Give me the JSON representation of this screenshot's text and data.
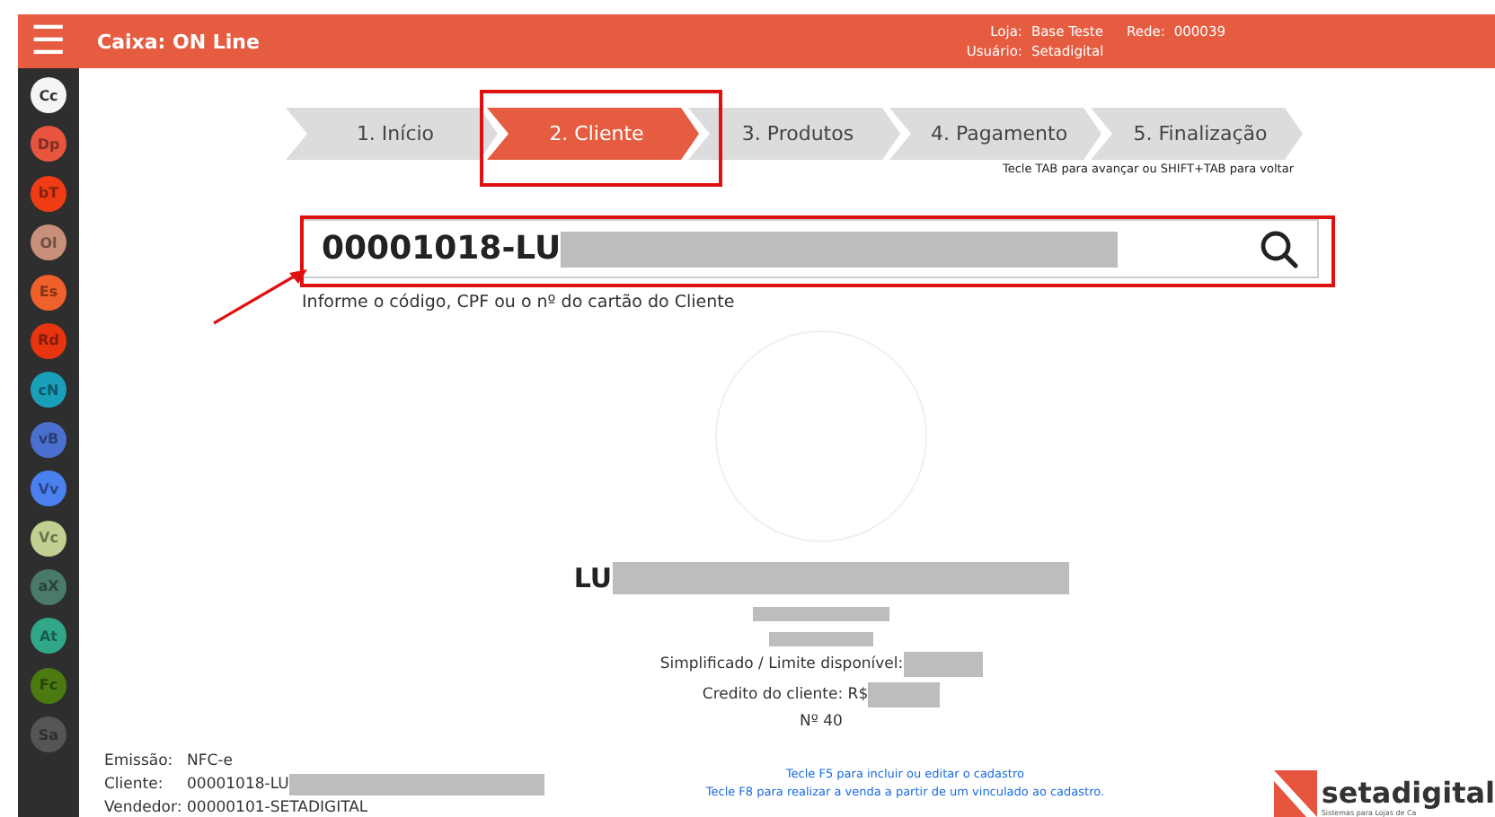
{
  "header": {
    "menu_icon": "☰",
    "title": "Caixa: ON Line",
    "loja_label": "Loja:",
    "loja": "Base Teste",
    "rede_label": "Rede:",
    "rede": "000039",
    "usuario_label": "Usuário:",
    "usuario": "Setadigital"
  },
  "sidebar": {
    "items": [
      {
        "label": "Cc",
        "color": "#f4f4f4"
      },
      {
        "label": "Dp",
        "color": "#e8553f"
      },
      {
        "label": "bT",
        "color": "#f03c14"
      },
      {
        "label": "Ol",
        "color": "#c8907a"
      },
      {
        "label": "Es",
        "color": "#f0602a"
      },
      {
        "label": "Rd",
        "color": "#e8350f"
      },
      {
        "label": "cN",
        "color": "#1a9fb8"
      },
      {
        "label": "vB",
        "color": "#4a70d0"
      },
      {
        "label": "Vv",
        "color": "#4a80f0"
      },
      {
        "label": "Vc",
        "color": "#c0d090"
      },
      {
        "label": "aX",
        "color": "#4a7a6a"
      },
      {
        "label": "At",
        "color": "#30a888"
      },
      {
        "label": "Fc",
        "color": "#4a7a10"
      },
      {
        "label": "Sa",
        "color": "#555555"
      }
    ]
  },
  "steps": [
    {
      "label": "1. Início",
      "selected": false
    },
    {
      "label": "2. Cliente",
      "selected": true
    },
    {
      "label": "3. Produtos",
      "selected": false
    },
    {
      "label": "4. Pagamento",
      "selected": false
    },
    {
      "label": "5. Finalização",
      "selected": false
    }
  ],
  "steps_hint": "Tecle TAB para avançar ou SHIFT+TAB para voltar",
  "search": {
    "value": "00001018-LU",
    "hint": "Informe o código, CPF ou o nº do cartão do Cliente"
  },
  "client": {
    "name": "LU",
    "limit": "Simplificado / Limite disponível:",
    "credit": "Credito do cliente: R$",
    "number": "Nº 40"
  },
  "footer": {
    "rows": [
      {
        "label": "Emissão:",
        "value": "NFC-e",
        "redacted": false
      },
      {
        "label": "Cliente:",
        "value": "00001018-LU",
        "redacted": true
      },
      {
        "label": "Vendedor:",
        "value": "00000101-SETADIGITAL",
        "redacted": false
      }
    ],
    "hints": [
      "Tecle F5 para incluir ou editar o cadastro",
      "Tecle F8 para realizar a venda a partir  de um vinculado ao cadastro."
    ],
    "logo": "setadigital",
    "logo_tagline": "Sistemas para Lojas de Ca"
  }
}
